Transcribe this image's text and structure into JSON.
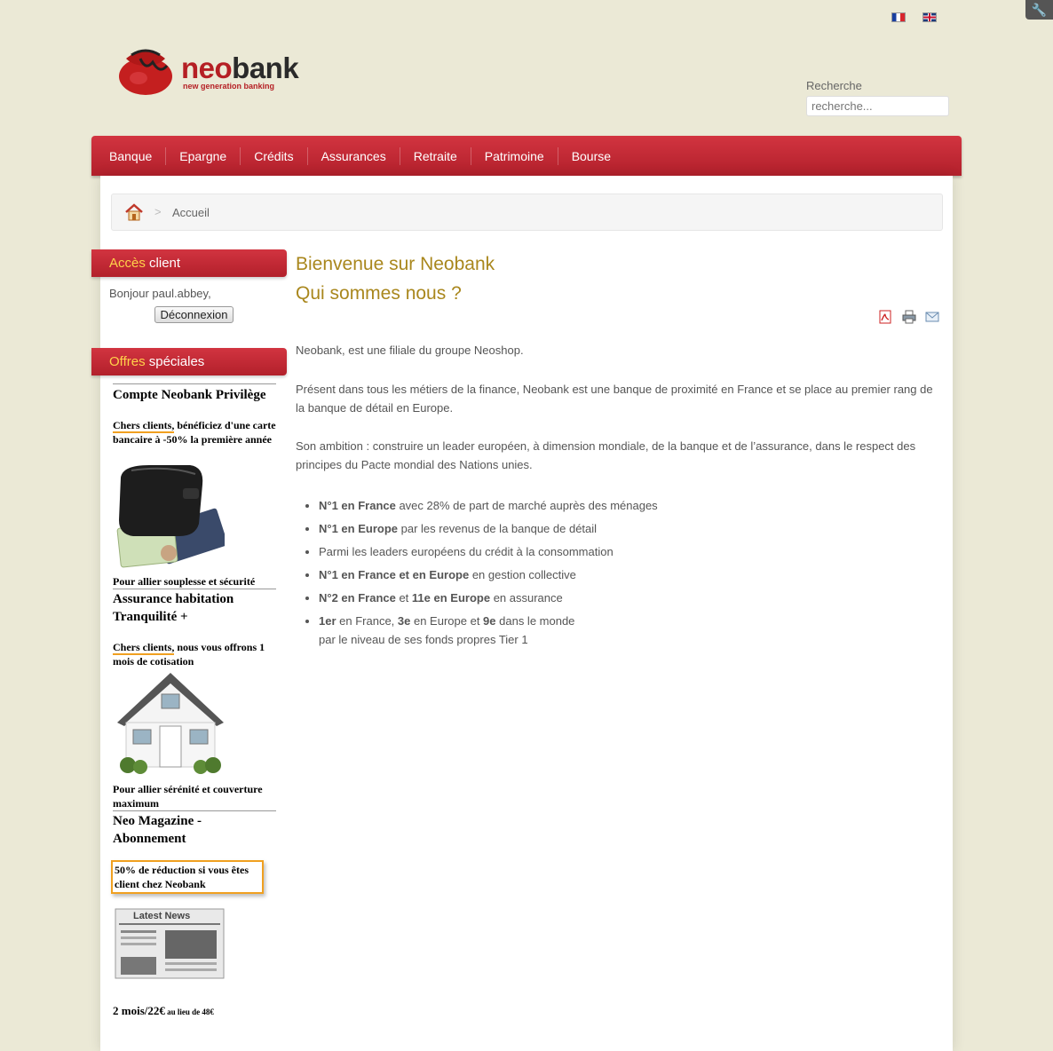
{
  "header": {
    "flags": [
      "fr-flag-icon",
      "uk-flag-icon"
    ],
    "tools_icon": "wrench-icon",
    "logo": {
      "word_neo": "neo",
      "word_bank": "bank",
      "tagline": "new generation banking"
    },
    "search": {
      "label": "Recherche",
      "placeholder": "recherche..."
    }
  },
  "nav": {
    "items": [
      "Banque",
      "Epargne",
      "Crédits",
      "Assurances",
      "Retraite",
      "Patrimoine",
      "Bourse"
    ]
  },
  "breadcrumb": {
    "home_icon": "home-icon",
    "separator": ">",
    "current": "Accueil"
  },
  "sidebar": {
    "client": {
      "title_hl": "Accès",
      "title_rest": " client",
      "greeting": "Bonjour paul.abbey,",
      "logout": "Déconnexion"
    },
    "offers": {
      "title_hl": "Offres",
      "title_rest": " spéciales",
      "items": [
        {
          "title": "Compte Neobank Privilège",
          "lead": "Chers clients,",
          "text": " bénéficiez d'une carte bancaire à -50% la première année",
          "image": "wallet-cards-image",
          "footer": "Pour allier souplesse et sécurité"
        },
        {
          "title": "Assurance habitation Tranquilité +",
          "lead": "Chers clients,",
          "text": " nous vous offrons 1 mois de cotisation",
          "image": "house-image",
          "footer": "Pour allier sérénité et couverture maximum"
        },
        {
          "title": "Neo Magazine - Abonnement",
          "text": "50% de réduction si vous êtes client chez Neobank",
          "image": "newspaper-image",
          "image_headline": "Latest News",
          "price": "2 mois/22€",
          "price_note": " au lieu de 48€"
        }
      ]
    }
  },
  "main": {
    "title_line1": "Bienvenue sur Neobank",
    "title_line2": "Qui sommes nous ?",
    "action_icons": [
      "pdf-icon",
      "print-icon",
      "email-icon"
    ],
    "paragraphs": [
      "Neobank, est une filiale du groupe Neoshop.",
      "Présent dans tous les métiers de la finance, Neobank est une banque de proximité en France et se place au premier rang de la banque de détail en Europe.",
      "Son ambition : construire un leader européen, à dimension mondiale, de la banque et de l’assurance, dans le respect des principes du Pacte mondial des Nations unies."
    ],
    "list": [
      {
        "b": "N°1 en France",
        "t": " avec 28% de part de marché auprès des ménages"
      },
      {
        "b": "N°1 en Europe",
        "t": " par les revenus de la banque de détail"
      },
      {
        "b": "",
        "t": "Parmi les leaders européens du crédit à la consommation"
      },
      {
        "b": "N°1 en France et en Europe",
        "t": " en gestion collective"
      },
      {
        "b1": "N°2 en France",
        "m1": " et ",
        "b2": "11e en Europe",
        "t": " en assurance"
      },
      {
        "b1": "1er",
        "m1": " en France, ",
        "b2": "3e",
        "m2": " en Europe et ",
        "b3": "9e",
        "t": " dans le monde",
        "line2": "par le niveau de ses fonds propres Tier 1"
      }
    ]
  }
}
